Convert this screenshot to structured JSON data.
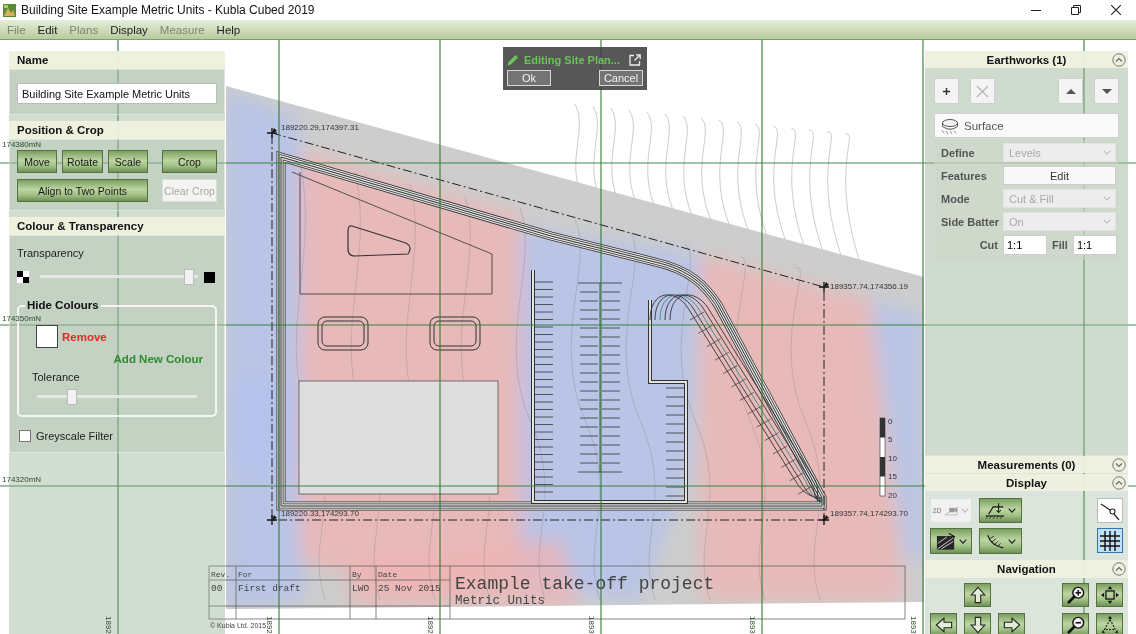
{
  "window": {
    "title": "Building Site Example Metric Units - Kubla Cubed 2019"
  },
  "menu": [
    {
      "label": "File",
      "disabled": true
    },
    {
      "label": "Edit",
      "disabled": false
    },
    {
      "label": "Plans",
      "disabled": true
    },
    {
      "label": "Display",
      "disabled": false
    },
    {
      "label": "Measure",
      "disabled": true
    },
    {
      "label": "Help",
      "disabled": false
    }
  ],
  "left_panel": {
    "name_section": {
      "title": "Name",
      "value": "Building Site Example Metric Units"
    },
    "position_crop": {
      "title": "Position & Crop",
      "buttons": [
        {
          "label": "Move",
          "disabled": false
        },
        {
          "label": "Rotate",
          "disabled": false
        },
        {
          "label": "Scale",
          "disabled": false
        },
        {
          "label": "Crop",
          "disabled": false
        },
        {
          "label": "Align to Two Points",
          "disabled": false
        },
        {
          "label": "Clear Crop",
          "disabled": true
        }
      ]
    },
    "colour_transparency": {
      "title": "Colour & Transparency",
      "transparency": {
        "label": "Transparency",
        "level": 0.97
      },
      "hide_colours": {
        "title": "Hide Colours",
        "colours": [
          {
            "color": "#ffffff",
            "action": "Remove"
          }
        ],
        "add_label": "Add New Colour",
        "tolerance": {
          "label": "Tolerance",
          "level": 0.2
        }
      },
      "greyscale_filter": {
        "label": "Greyscale Filter",
        "checked": false
      }
    }
  },
  "edit_dialog": {
    "title": "Editing Site Plan...",
    "buttons": [
      "Ok",
      "Cancel"
    ]
  },
  "canvas": {
    "grid": {
      "row_labels": [
        "174380mN",
        "174350mN",
        "174320mN"
      ],
      "column_labels": [
        "1892",
        "1892",
        "1892",
        "1893",
        "1893",
        "1893"
      ]
    },
    "corner_labels": [
      "189220.29,174397.31",
      "189357.74,174356.19",
      "189220.33,174293.70",
      "189357.74,174293.70"
    ],
    "scale_labels": [
      "0",
      "5",
      "10",
      "15",
      "20"
    ],
    "title_block": {
      "headers": [
        "Rev.",
        "For",
        "By",
        "Date"
      ],
      "row": [
        "00",
        "First draft",
        "LWO",
        "25 Nov 2015"
      ],
      "title": "Example take-off project",
      "subtitle": "Metric Units",
      "copyright": "© Kubla Ltd. 2015"
    }
  },
  "right_panel": {
    "earthworks": {
      "title": "Earthworks (1)",
      "expanded": true,
      "tools": [
        {
          "kind": "add",
          "disabled": false
        },
        {
          "kind": "delete",
          "disabled": true
        },
        {
          "kind": "move-up",
          "disabled": false
        },
        {
          "kind": "move-down",
          "disabled": false
        }
      ],
      "items": [
        {
          "label": "Surface"
        }
      ],
      "properties": [
        {
          "label": "Define",
          "kind": "dropdown",
          "value": "Levels",
          "disabled": true
        },
        {
          "label": "Features",
          "kind": "button",
          "value": "Edit",
          "disabled": false
        },
        {
          "label": "Mode",
          "kind": "dropdown",
          "value": "Cut & Fill",
          "disabled": true
        },
        {
          "label": "Side Batter",
          "kind": "dropdown",
          "value": "On",
          "disabled": true
        }
      ],
      "batter_slopes": [
        {
          "label": "Cut",
          "value": "1:1"
        },
        {
          "label": "Fill",
          "value": "1:1"
        }
      ]
    },
    "measurements": {
      "title": "Measurements (0)",
      "expanded": false
    },
    "display": {
      "title": "Display",
      "expanded": true,
      "tools": [
        {
          "kind": "view-mode",
          "label": "2D",
          "disabled": true
        },
        {
          "kind": "levels",
          "disabled": false
        },
        {
          "kind": "texture",
          "disabled": false
        },
        {
          "kind": "batter",
          "disabled": false
        }
      ],
      "toggles": [
        {
          "kind": "measure-line",
          "on": false
        },
        {
          "kind": "grid",
          "on": true
        }
      ]
    },
    "navigation": {
      "title": "Navigation",
      "expanded": true,
      "buttons": [
        {
          "kind": "pan-up"
        },
        {
          "kind": "zoom-in"
        },
        {
          "kind": "zoom-extents"
        },
        {
          "kind": "pan-left"
        },
        {
          "kind": "pan-down"
        },
        {
          "kind": "pan-right"
        },
        {
          "kind": "zoom-out"
        },
        {
          "kind": "zoom-selection"
        }
      ]
    }
  }
}
